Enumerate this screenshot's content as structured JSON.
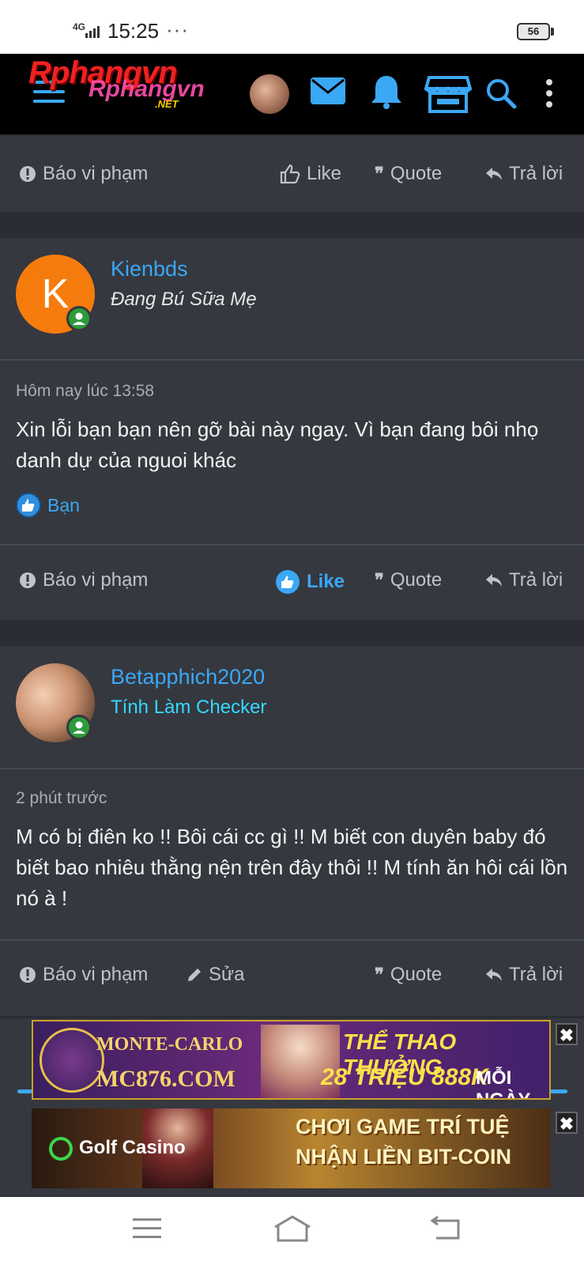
{
  "status": {
    "network": "4G",
    "time": "15:25",
    "dots": "···",
    "battery": "56"
  },
  "header": {
    "logo_main": "Rphangvn",
    "logo_sub": "Rphangvn",
    "logo_net": ".NET"
  },
  "actions": {
    "report": "Báo vi phạm",
    "like": "Like",
    "quote": "Quote",
    "reply": "Trả lời",
    "edit": "Sửa"
  },
  "posts": [
    {
      "username": "Kienbds",
      "avatar_letter": "K",
      "user_title": "Đang Bú Sữa Mẹ",
      "time": "Hôm nay lúc 13:58",
      "body": "Xin lỗi bạn bạn nên gỡ bài này ngay. Vì bạn đang bôi nhọ danh dự của nguoi khác",
      "reaction_by": "Bạn"
    },
    {
      "username": "Betapphich2020",
      "user_title": "Tính Làm Checker",
      "time": "2 phút trước",
      "body": "M có bị điên ko !! Bôi cái cc gì !! M biết con duyên baby đó biết bao nhiêu thằng nện trên đây thôi !! M tính ăn hôi cái lồn nó à !"
    }
  ],
  "ads": [
    {
      "brand": "MONTE-CARLO",
      "site": "MC876.COM",
      "line1": "THỂ THAO THƯỞNG",
      "line2": "28 TRIỆU 888K",
      "line3": "MỖI NGÀY"
    },
    {
      "brand": "Golf Casino",
      "line1": "CHƠI GAME TRÍ TUỆ",
      "line2": "NHẬN LIỀN BIT-COIN"
    }
  ],
  "close_glyph": "✖",
  "colors": {
    "accent": "#3ba8f5",
    "panel": "#35383f",
    "title_cyan": "#35d8ff",
    "online": "#2e9b3c"
  }
}
